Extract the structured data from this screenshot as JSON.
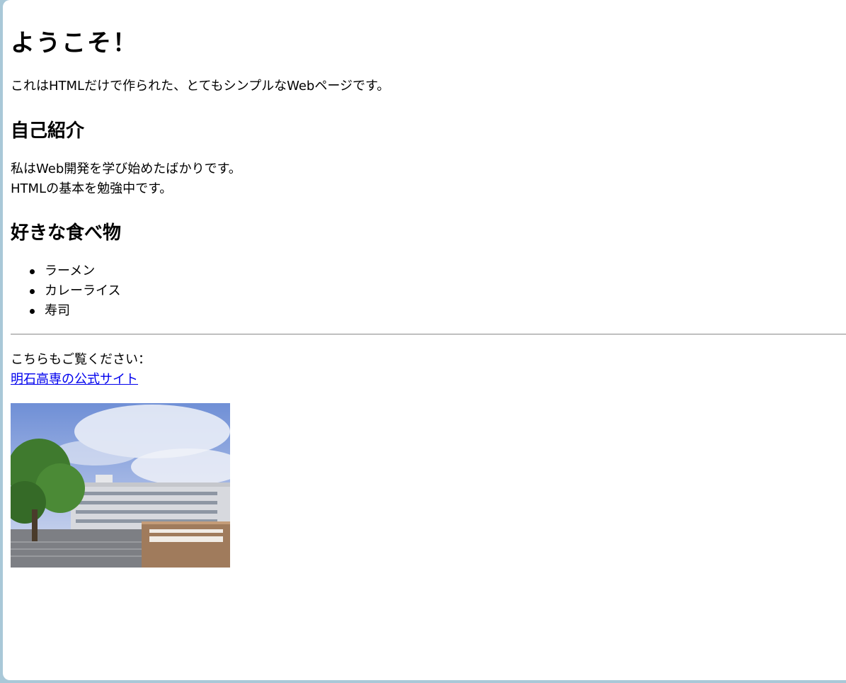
{
  "page": {
    "heading": "ようこそ！",
    "intro": "これはHTMLだけで作られた、とてもシンプルなWebページです。"
  },
  "about": {
    "heading": "自己紹介",
    "line1": "私はWeb開発を学び始めたばかりです。",
    "line2": "HTMLの基本を勉強中です。"
  },
  "favorites": {
    "heading": "好きな食べ物",
    "items": [
      "ラーメン",
      "カレーライス",
      "寿司"
    ]
  },
  "links": {
    "lead": "こちらもご覧ください：",
    "label": "明石高専の公式サイト"
  },
  "photo": {
    "subject": "campus building with school name sign"
  },
  "colors": {
    "link": "#0000ee",
    "frame": "#a9c8d8"
  }
}
